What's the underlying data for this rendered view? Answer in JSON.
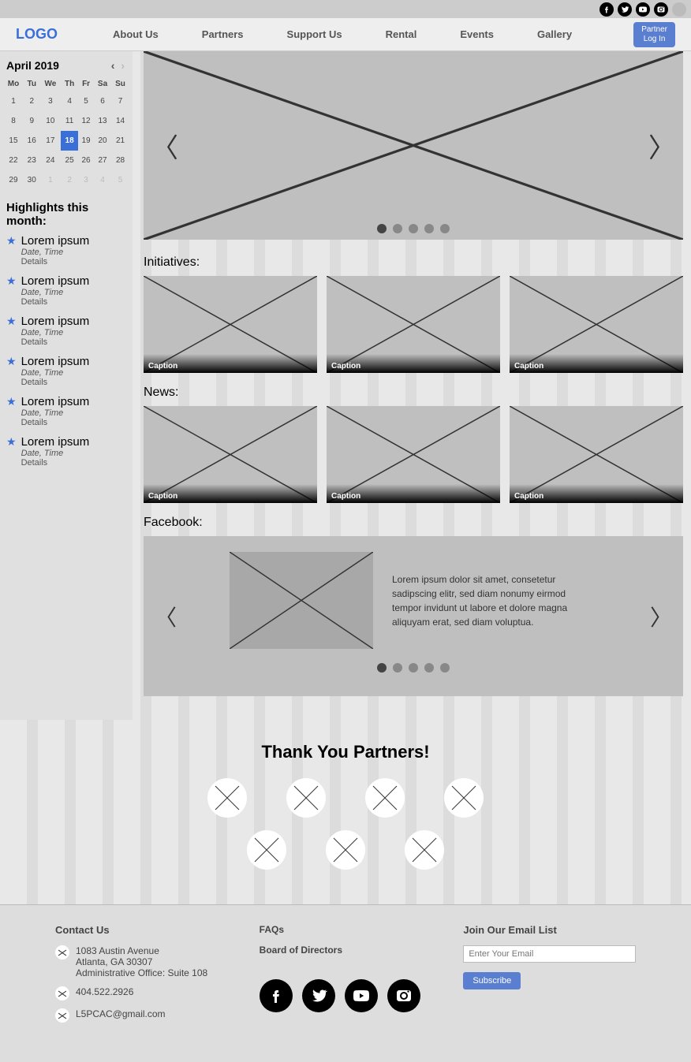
{
  "logo": "LOGO",
  "nav": [
    "About Us",
    "Partners",
    "Support Us",
    "Rental",
    "Events",
    "Gallery"
  ],
  "login_btn_line1": "Partner",
  "login_btn_line2": "Log In",
  "calendar": {
    "title": "April 2019",
    "dow": [
      "Mo",
      "Tu",
      "We",
      "Th",
      "Fr",
      "Sa",
      "Su"
    ],
    "weeks": [
      [
        {
          "d": 1
        },
        {
          "d": 2
        },
        {
          "d": 3
        },
        {
          "d": 4
        },
        {
          "d": 5
        },
        {
          "d": 6
        },
        {
          "d": 7
        }
      ],
      [
        {
          "d": 8
        },
        {
          "d": 9
        },
        {
          "d": 10
        },
        {
          "d": 11
        },
        {
          "d": 12
        },
        {
          "d": 13
        },
        {
          "d": 14
        }
      ],
      [
        {
          "d": 15
        },
        {
          "d": 16
        },
        {
          "d": 17
        },
        {
          "d": 18,
          "sel": true
        },
        {
          "d": 19
        },
        {
          "d": 20
        },
        {
          "d": 21
        }
      ],
      [
        {
          "d": 22
        },
        {
          "d": 23
        },
        {
          "d": 24
        },
        {
          "d": 25
        },
        {
          "d": 26
        },
        {
          "d": 27
        },
        {
          "d": 28
        }
      ],
      [
        {
          "d": 29
        },
        {
          "d": 30
        },
        {
          "d": 1,
          "o": true
        },
        {
          "d": 2,
          "o": true
        },
        {
          "d": 3,
          "o": true
        },
        {
          "d": 4,
          "o": true
        },
        {
          "d": 5,
          "o": true
        }
      ]
    ]
  },
  "highlights_title": "Highlights this month:",
  "highlights": [
    {
      "title": "Lorem ipsum",
      "meta": "Date, Time",
      "det": "Details"
    },
    {
      "title": "Lorem ipsum",
      "meta": "Date, Time",
      "det": "Details"
    },
    {
      "title": "Lorem ipsum",
      "meta": "Date, Time",
      "det": "Details"
    },
    {
      "title": "Lorem ipsum",
      "meta": "Date, Time",
      "det": "Details"
    },
    {
      "title": "Lorem ipsum",
      "meta": "Date, Time",
      "det": "Details"
    },
    {
      "title": "Lorem ipsum",
      "meta": "Date, Time",
      "det": "Details"
    }
  ],
  "sections": {
    "initiatives_title": "Initiatives:",
    "news_title": "News:",
    "facebook_title": "Facebook:"
  },
  "caption": "Caption",
  "fb_text": "Lorem ipsum dolor sit amet, consetetur sadipscing elitr, sed diam nonumy eirmod tempor invidunt ut labore et dolore magna aliquyam erat, sed diam voluptua.",
  "partners_title": "Thank You Partners!",
  "footer": {
    "contact_title": "Contact Us",
    "address1": "1083 Austin Avenue",
    "address2": "Atlanta, GA 30307",
    "address3": "Administrative Office: Suite 108",
    "phone": "404.522.2926",
    "email": "L5PCAC@gmail.com",
    "faqs": "FAQs",
    "board": "Board of Directors",
    "join_title": "Join Our Email List",
    "email_placeholder": "Enter Your Email",
    "subscribe": "Subscribe"
  }
}
